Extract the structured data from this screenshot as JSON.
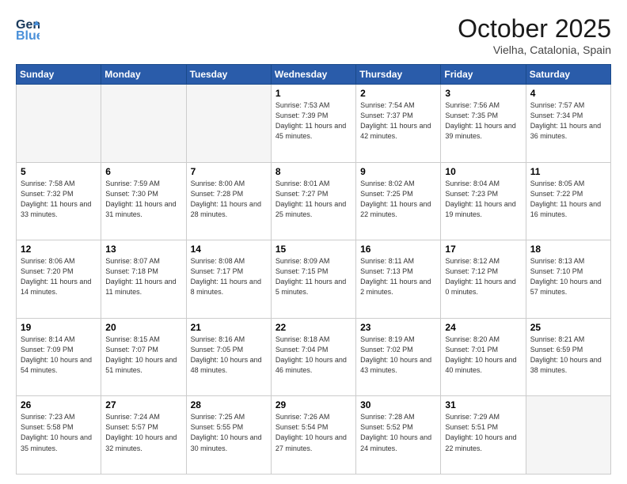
{
  "header": {
    "logo_line1": "General",
    "logo_line2": "Blue",
    "month": "October 2025",
    "location": "Vielha, Catalonia, Spain"
  },
  "days_of_week": [
    "Sunday",
    "Monday",
    "Tuesday",
    "Wednesday",
    "Thursday",
    "Friday",
    "Saturday"
  ],
  "weeks": [
    [
      {
        "day": "",
        "sunrise": "",
        "sunset": "",
        "daylight": "",
        "empty": true
      },
      {
        "day": "",
        "sunrise": "",
        "sunset": "",
        "daylight": "",
        "empty": true
      },
      {
        "day": "",
        "sunrise": "",
        "sunset": "",
        "daylight": "",
        "empty": true
      },
      {
        "day": "1",
        "sunrise": "Sunrise: 7:53 AM",
        "sunset": "Sunset: 7:39 PM",
        "daylight": "Daylight: 11 hours and 45 minutes."
      },
      {
        "day": "2",
        "sunrise": "Sunrise: 7:54 AM",
        "sunset": "Sunset: 7:37 PM",
        "daylight": "Daylight: 11 hours and 42 minutes."
      },
      {
        "day": "3",
        "sunrise": "Sunrise: 7:56 AM",
        "sunset": "Sunset: 7:35 PM",
        "daylight": "Daylight: 11 hours and 39 minutes."
      },
      {
        "day": "4",
        "sunrise": "Sunrise: 7:57 AM",
        "sunset": "Sunset: 7:34 PM",
        "daylight": "Daylight: 11 hours and 36 minutes."
      }
    ],
    [
      {
        "day": "5",
        "sunrise": "Sunrise: 7:58 AM",
        "sunset": "Sunset: 7:32 PM",
        "daylight": "Daylight: 11 hours and 33 minutes."
      },
      {
        "day": "6",
        "sunrise": "Sunrise: 7:59 AM",
        "sunset": "Sunset: 7:30 PM",
        "daylight": "Daylight: 11 hours and 31 minutes."
      },
      {
        "day": "7",
        "sunrise": "Sunrise: 8:00 AM",
        "sunset": "Sunset: 7:28 PM",
        "daylight": "Daylight: 11 hours and 28 minutes."
      },
      {
        "day": "8",
        "sunrise": "Sunrise: 8:01 AM",
        "sunset": "Sunset: 7:27 PM",
        "daylight": "Daylight: 11 hours and 25 minutes."
      },
      {
        "day": "9",
        "sunrise": "Sunrise: 8:02 AM",
        "sunset": "Sunset: 7:25 PM",
        "daylight": "Daylight: 11 hours and 22 minutes."
      },
      {
        "day": "10",
        "sunrise": "Sunrise: 8:04 AM",
        "sunset": "Sunset: 7:23 PM",
        "daylight": "Daylight: 11 hours and 19 minutes."
      },
      {
        "day": "11",
        "sunrise": "Sunrise: 8:05 AM",
        "sunset": "Sunset: 7:22 PM",
        "daylight": "Daylight: 11 hours and 16 minutes."
      }
    ],
    [
      {
        "day": "12",
        "sunrise": "Sunrise: 8:06 AM",
        "sunset": "Sunset: 7:20 PM",
        "daylight": "Daylight: 11 hours and 14 minutes."
      },
      {
        "day": "13",
        "sunrise": "Sunrise: 8:07 AM",
        "sunset": "Sunset: 7:18 PM",
        "daylight": "Daylight: 11 hours and 11 minutes."
      },
      {
        "day": "14",
        "sunrise": "Sunrise: 8:08 AM",
        "sunset": "Sunset: 7:17 PM",
        "daylight": "Daylight: 11 hours and 8 minutes."
      },
      {
        "day": "15",
        "sunrise": "Sunrise: 8:09 AM",
        "sunset": "Sunset: 7:15 PM",
        "daylight": "Daylight: 11 hours and 5 minutes."
      },
      {
        "day": "16",
        "sunrise": "Sunrise: 8:11 AM",
        "sunset": "Sunset: 7:13 PM",
        "daylight": "Daylight: 11 hours and 2 minutes."
      },
      {
        "day": "17",
        "sunrise": "Sunrise: 8:12 AM",
        "sunset": "Sunset: 7:12 PM",
        "daylight": "Daylight: 11 hours and 0 minutes."
      },
      {
        "day": "18",
        "sunrise": "Sunrise: 8:13 AM",
        "sunset": "Sunset: 7:10 PM",
        "daylight": "Daylight: 10 hours and 57 minutes."
      }
    ],
    [
      {
        "day": "19",
        "sunrise": "Sunrise: 8:14 AM",
        "sunset": "Sunset: 7:09 PM",
        "daylight": "Daylight: 10 hours and 54 minutes."
      },
      {
        "day": "20",
        "sunrise": "Sunrise: 8:15 AM",
        "sunset": "Sunset: 7:07 PM",
        "daylight": "Daylight: 10 hours and 51 minutes."
      },
      {
        "day": "21",
        "sunrise": "Sunrise: 8:16 AM",
        "sunset": "Sunset: 7:05 PM",
        "daylight": "Daylight: 10 hours and 48 minutes."
      },
      {
        "day": "22",
        "sunrise": "Sunrise: 8:18 AM",
        "sunset": "Sunset: 7:04 PM",
        "daylight": "Daylight: 10 hours and 46 minutes."
      },
      {
        "day": "23",
        "sunrise": "Sunrise: 8:19 AM",
        "sunset": "Sunset: 7:02 PM",
        "daylight": "Daylight: 10 hours and 43 minutes."
      },
      {
        "day": "24",
        "sunrise": "Sunrise: 8:20 AM",
        "sunset": "Sunset: 7:01 PM",
        "daylight": "Daylight: 10 hours and 40 minutes."
      },
      {
        "day": "25",
        "sunrise": "Sunrise: 8:21 AM",
        "sunset": "Sunset: 6:59 PM",
        "daylight": "Daylight: 10 hours and 38 minutes."
      }
    ],
    [
      {
        "day": "26",
        "sunrise": "Sunrise: 7:23 AM",
        "sunset": "Sunset: 5:58 PM",
        "daylight": "Daylight: 10 hours and 35 minutes."
      },
      {
        "day": "27",
        "sunrise": "Sunrise: 7:24 AM",
        "sunset": "Sunset: 5:57 PM",
        "daylight": "Daylight: 10 hours and 32 minutes."
      },
      {
        "day": "28",
        "sunrise": "Sunrise: 7:25 AM",
        "sunset": "Sunset: 5:55 PM",
        "daylight": "Daylight: 10 hours and 30 minutes."
      },
      {
        "day": "29",
        "sunrise": "Sunrise: 7:26 AM",
        "sunset": "Sunset: 5:54 PM",
        "daylight": "Daylight: 10 hours and 27 minutes."
      },
      {
        "day": "30",
        "sunrise": "Sunrise: 7:28 AM",
        "sunset": "Sunset: 5:52 PM",
        "daylight": "Daylight: 10 hours and 24 minutes."
      },
      {
        "day": "31",
        "sunrise": "Sunrise: 7:29 AM",
        "sunset": "Sunset: 5:51 PM",
        "daylight": "Daylight: 10 hours and 22 minutes."
      },
      {
        "day": "",
        "sunrise": "",
        "sunset": "",
        "daylight": "",
        "empty": true
      }
    ]
  ]
}
